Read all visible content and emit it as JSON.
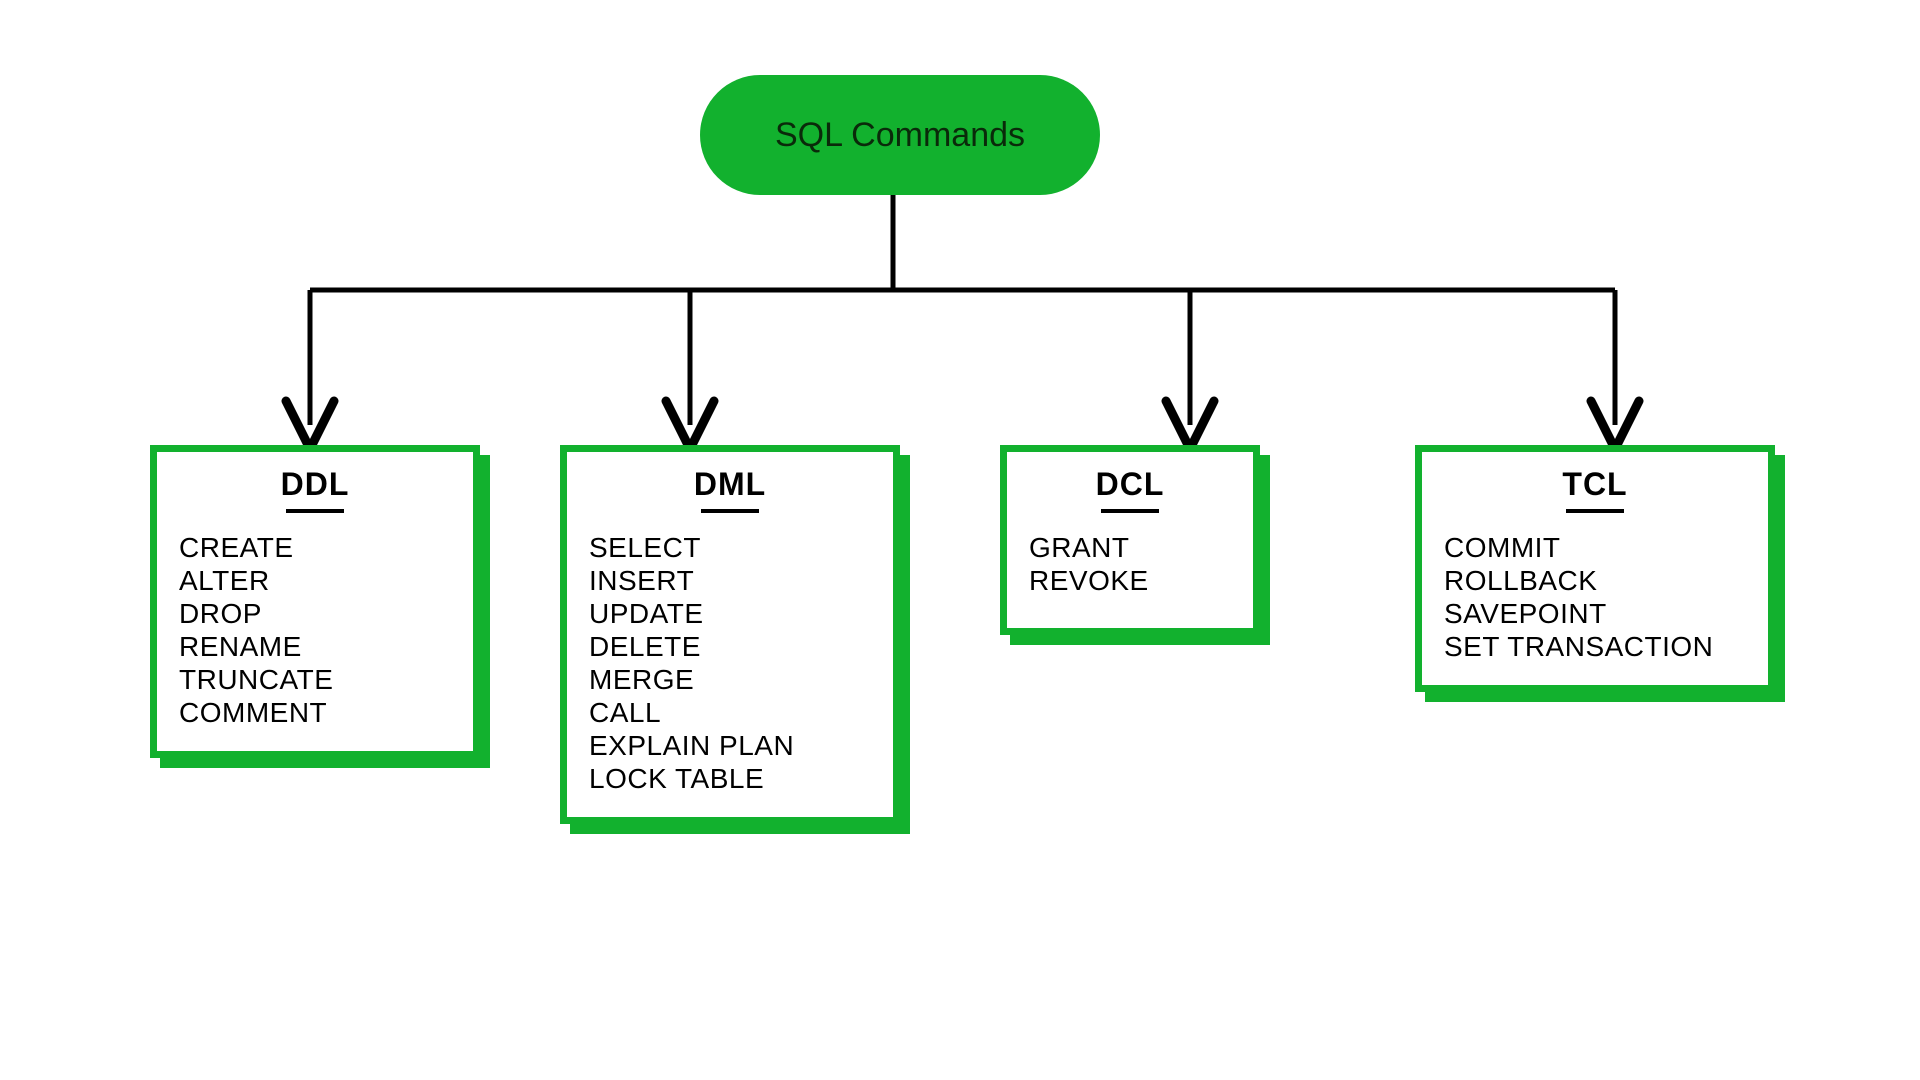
{
  "root": {
    "label": "SQL Commands"
  },
  "boxes": {
    "ddl": {
      "title": "DDL",
      "items": [
        "CREATE",
        "ALTER",
        "DROP",
        "RENAME",
        "TRUNCATE",
        "COMMENT"
      ]
    },
    "dml": {
      "title": "DML",
      "items": [
        "SELECT",
        "INSERT",
        "UPDATE",
        "DELETE",
        "MERGE",
        "CALL",
        "EXPLAIN PLAN",
        "LOCK TABLE"
      ]
    },
    "dcl": {
      "title": "DCL",
      "items": [
        "GRANT",
        "REVOKE"
      ]
    },
    "tcl": {
      "title": "TCL",
      "items": [
        "COMMIT",
        "ROLLBACK",
        "SAVEPOINT",
        "SET TRANSACTION"
      ]
    }
  },
  "colors": {
    "accent": "#12b12e"
  }
}
